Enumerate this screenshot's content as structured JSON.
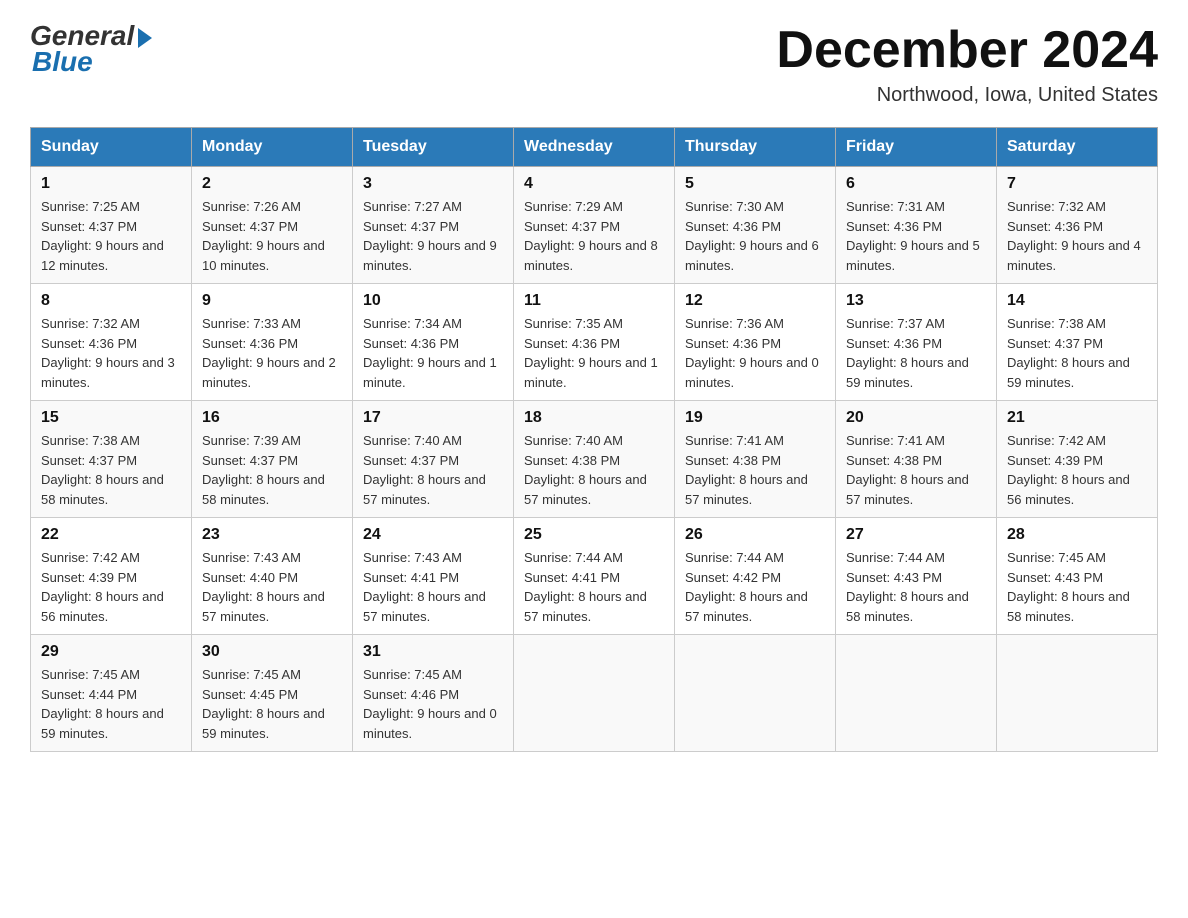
{
  "header": {
    "logo_general": "General",
    "logo_blue": "Blue",
    "month_title": "December 2024",
    "subtitle": "Northwood, Iowa, United States"
  },
  "days_of_week": [
    "Sunday",
    "Monday",
    "Tuesday",
    "Wednesday",
    "Thursday",
    "Friday",
    "Saturday"
  ],
  "weeks": [
    [
      {
        "day": "1",
        "sunrise": "7:25 AM",
        "sunset": "4:37 PM",
        "daylight": "9 hours and 12 minutes."
      },
      {
        "day": "2",
        "sunrise": "7:26 AM",
        "sunset": "4:37 PM",
        "daylight": "9 hours and 10 minutes."
      },
      {
        "day": "3",
        "sunrise": "7:27 AM",
        "sunset": "4:37 PM",
        "daylight": "9 hours and 9 minutes."
      },
      {
        "day": "4",
        "sunrise": "7:29 AM",
        "sunset": "4:37 PM",
        "daylight": "9 hours and 8 minutes."
      },
      {
        "day": "5",
        "sunrise": "7:30 AM",
        "sunset": "4:36 PM",
        "daylight": "9 hours and 6 minutes."
      },
      {
        "day": "6",
        "sunrise": "7:31 AM",
        "sunset": "4:36 PM",
        "daylight": "9 hours and 5 minutes."
      },
      {
        "day": "7",
        "sunrise": "7:32 AM",
        "sunset": "4:36 PM",
        "daylight": "9 hours and 4 minutes."
      }
    ],
    [
      {
        "day": "8",
        "sunrise": "7:32 AM",
        "sunset": "4:36 PM",
        "daylight": "9 hours and 3 minutes."
      },
      {
        "day": "9",
        "sunrise": "7:33 AM",
        "sunset": "4:36 PM",
        "daylight": "9 hours and 2 minutes."
      },
      {
        "day": "10",
        "sunrise": "7:34 AM",
        "sunset": "4:36 PM",
        "daylight": "9 hours and 1 minute."
      },
      {
        "day": "11",
        "sunrise": "7:35 AM",
        "sunset": "4:36 PM",
        "daylight": "9 hours and 1 minute."
      },
      {
        "day": "12",
        "sunrise": "7:36 AM",
        "sunset": "4:36 PM",
        "daylight": "9 hours and 0 minutes."
      },
      {
        "day": "13",
        "sunrise": "7:37 AM",
        "sunset": "4:36 PM",
        "daylight": "8 hours and 59 minutes."
      },
      {
        "day": "14",
        "sunrise": "7:38 AM",
        "sunset": "4:37 PM",
        "daylight": "8 hours and 59 minutes."
      }
    ],
    [
      {
        "day": "15",
        "sunrise": "7:38 AM",
        "sunset": "4:37 PM",
        "daylight": "8 hours and 58 minutes."
      },
      {
        "day": "16",
        "sunrise": "7:39 AM",
        "sunset": "4:37 PM",
        "daylight": "8 hours and 58 minutes."
      },
      {
        "day": "17",
        "sunrise": "7:40 AM",
        "sunset": "4:37 PM",
        "daylight": "8 hours and 57 minutes."
      },
      {
        "day": "18",
        "sunrise": "7:40 AM",
        "sunset": "4:38 PM",
        "daylight": "8 hours and 57 minutes."
      },
      {
        "day": "19",
        "sunrise": "7:41 AM",
        "sunset": "4:38 PM",
        "daylight": "8 hours and 57 minutes."
      },
      {
        "day": "20",
        "sunrise": "7:41 AM",
        "sunset": "4:38 PM",
        "daylight": "8 hours and 57 minutes."
      },
      {
        "day": "21",
        "sunrise": "7:42 AM",
        "sunset": "4:39 PM",
        "daylight": "8 hours and 56 minutes."
      }
    ],
    [
      {
        "day": "22",
        "sunrise": "7:42 AM",
        "sunset": "4:39 PM",
        "daylight": "8 hours and 56 minutes."
      },
      {
        "day": "23",
        "sunrise": "7:43 AM",
        "sunset": "4:40 PM",
        "daylight": "8 hours and 57 minutes."
      },
      {
        "day": "24",
        "sunrise": "7:43 AM",
        "sunset": "4:41 PM",
        "daylight": "8 hours and 57 minutes."
      },
      {
        "day": "25",
        "sunrise": "7:44 AM",
        "sunset": "4:41 PM",
        "daylight": "8 hours and 57 minutes."
      },
      {
        "day": "26",
        "sunrise": "7:44 AM",
        "sunset": "4:42 PM",
        "daylight": "8 hours and 57 minutes."
      },
      {
        "day": "27",
        "sunrise": "7:44 AM",
        "sunset": "4:43 PM",
        "daylight": "8 hours and 58 minutes."
      },
      {
        "day": "28",
        "sunrise": "7:45 AM",
        "sunset": "4:43 PM",
        "daylight": "8 hours and 58 minutes."
      }
    ],
    [
      {
        "day": "29",
        "sunrise": "7:45 AM",
        "sunset": "4:44 PM",
        "daylight": "8 hours and 59 minutes."
      },
      {
        "day": "30",
        "sunrise": "7:45 AM",
        "sunset": "4:45 PM",
        "daylight": "8 hours and 59 minutes."
      },
      {
        "day": "31",
        "sunrise": "7:45 AM",
        "sunset": "4:46 PM",
        "daylight": "9 hours and 0 minutes."
      },
      null,
      null,
      null,
      null
    ]
  ]
}
